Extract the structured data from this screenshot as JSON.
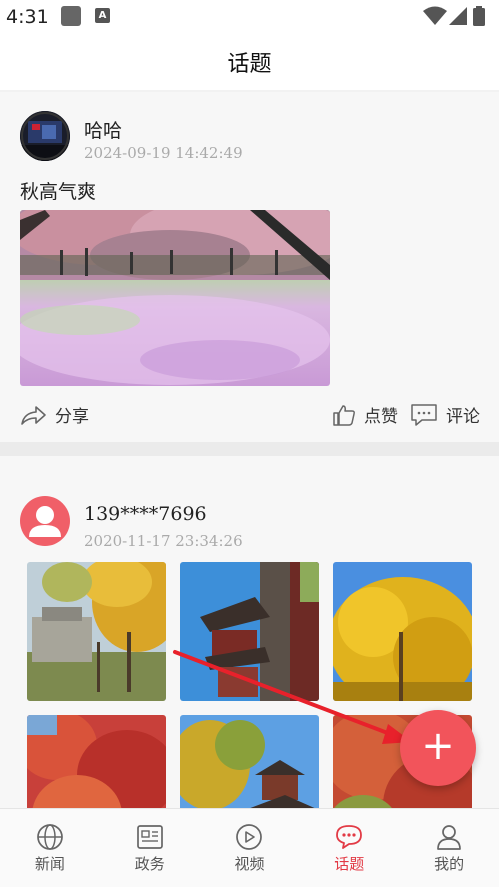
{
  "status_bar": {
    "time": "4:31",
    "notification_icon": "A"
  },
  "header": {
    "title": "话题"
  },
  "posts": [
    {
      "username": "哈哈",
      "timestamp": "2024-09-19  14:42:49",
      "text": "秋高气爽",
      "avatar_icon": "user-photo",
      "actions": {
        "share": "分享",
        "like": "点赞",
        "comment": "评论"
      }
    },
    {
      "username": "139****7696",
      "timestamp": "2020-11-17  23:34:26",
      "avatar_icon": "default-user-icon"
    }
  ],
  "fab": {
    "label": "+"
  },
  "bottom_nav": {
    "items": [
      {
        "label": "新闻",
        "icon": "globe-icon"
      },
      {
        "label": "政务",
        "icon": "newspaper-icon"
      },
      {
        "label": "视频",
        "icon": "play-icon"
      },
      {
        "label": "话题",
        "icon": "chat-icon",
        "active": true
      },
      {
        "label": "我的",
        "icon": "person-icon"
      }
    ]
  },
  "colors": {
    "accent": "#e23a45",
    "fab": "#f2545b",
    "annotation_arrow": "#e8212b"
  }
}
